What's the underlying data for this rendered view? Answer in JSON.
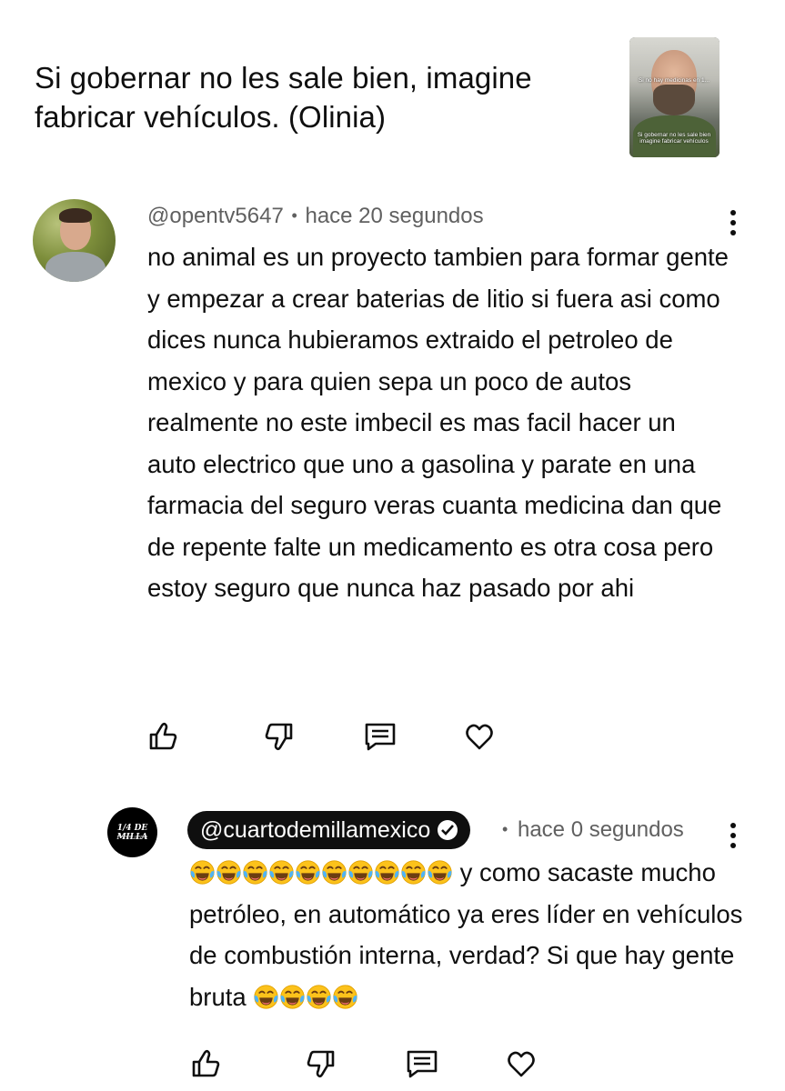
{
  "video": {
    "title": "Si gobernar no les sale bien, imagine fabricar vehículos. (Olinia)",
    "thumbnail_caption_top": "Si no hay medicinas en 1...",
    "thumbnail_caption_bottom": "Si gobernar no les sale bien imagine fabricar vehículos"
  },
  "comments": [
    {
      "handle": "@opentv5647",
      "separator": "•",
      "time": "hace 20 segundos",
      "text": "no animal es un proyecto tambien para formar gente y empezar a crear baterias de litio si fuera asi como dices nunca hubieramos extraido el petroleo de mexico y para quien sepa un poco de autos realmente no este imbecil es mas facil hacer un auto electrico que uno a gasolina y parate en una farmacia del seguro veras cuanta medicina dan que de repente falte un medicamento es otra cosa pero estoy seguro que nunca haz pasado por ahi"
    }
  ],
  "reply": {
    "handle": "@cuartodemillamexico",
    "verified": true,
    "separator": "•",
    "time": "hace 0 segundos",
    "avatar_logo": "1/4 DE MILLA",
    "avatar_sub": "Pasión de carreras",
    "text_after_emojis": "y como sacaste mucho petróleo, en automático ya eres líder en vehículos de combustión interna, verdad? Si que hay gente bruta",
    "leading_emoji_count": 10,
    "trailing_emoji_count": 4,
    "emoji": "face-with-tears-of-joy"
  },
  "icons": {
    "like": "thumb-up-icon",
    "dislike": "thumb-down-icon",
    "reply": "comment-icon",
    "heart": "heart-icon",
    "menu": "more-vert-icon"
  },
  "colors": {
    "text": "#0f0f0f",
    "secondary": "#606060",
    "pill_bg": "#0f0f0f",
    "emoji_face": "#fcc21b"
  }
}
